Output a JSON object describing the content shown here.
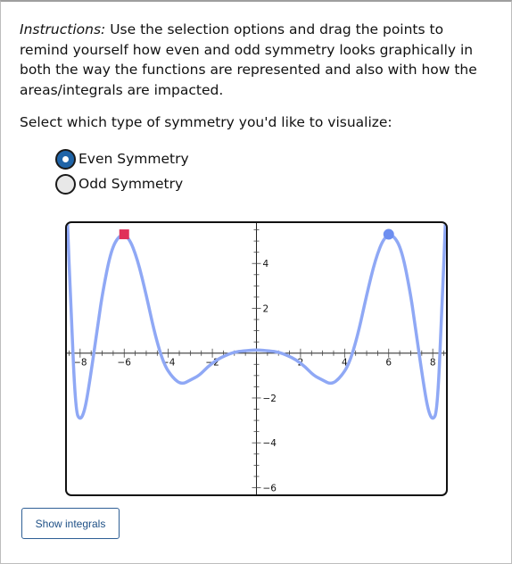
{
  "instructions": {
    "lead": "Instructions:",
    "text": " Use the selection options and drag the points to remind yourself how even and odd symmetry looks graphically in both the way the functions are represented and also with how the areas/integrals are impacted."
  },
  "question": "Select which type of symmetry you'd like to visualize:",
  "options": [
    {
      "label": "Even Symmetry",
      "selected": true
    },
    {
      "label": "Odd Symmetry",
      "selected": false
    }
  ],
  "button": {
    "label": "Show integrals"
  },
  "colors": {
    "curve": "#8fa8f5",
    "point_left": "#e0305a",
    "point_right": "#6d8ef0",
    "radio_selected": "#1f64a8"
  },
  "chart_data": {
    "type": "line",
    "xlim": [
      -8.6,
      8.6
    ],
    "ylim": [
      -6.3,
      5.8
    ],
    "x_ticks": [
      -8,
      -6,
      -4,
      -2,
      2,
      4,
      6,
      8
    ],
    "y_ticks": [
      -6,
      -4,
      -2,
      2,
      4
    ],
    "x_tick_labels": [
      "−8",
      "−6",
      "−4",
      "−2",
      "2",
      "4",
      "6",
      "8"
    ],
    "y_tick_labels": [
      "−6",
      "−4",
      "−2",
      "2",
      "4"
    ],
    "series": [
      {
        "x": [
          -8.6,
          -8.4,
          -8.2,
          -8.0,
          -7.8,
          -7.6,
          -7.2,
          -7.0,
          -6.6,
          -6.2,
          -5.8,
          -5.4,
          -5.0,
          -4.6,
          -4.2,
          -3.8,
          -3.4,
          -3.0,
          -2.6,
          -2.2,
          -1.8,
          -1.4,
          -1.0,
          -0.6,
          0,
          0.6,
          1.0,
          1.4,
          1.8,
          2.2,
          2.6,
          3.0,
          3.4,
          3.8,
          4.2,
          4.6,
          5.0,
          5.4,
          5.8,
          6.2,
          6.6,
          7.0,
          7.2,
          7.6,
          7.8,
          8.0,
          8.2,
          8.4,
          8.6
        ],
        "y": [
          6.5,
          1.5,
          -2.6,
          -3.0,
          -2.6,
          -1.5,
          1.2,
          2.6,
          4.6,
          5.3,
          5.2,
          4.2,
          2.6,
          0.8,
          -0.5,
          -1.1,
          -1.4,
          -1.2,
          -1.0,
          -0.6,
          -0.3,
          -0.1,
          0.05,
          0.1,
          0.15,
          0.1,
          0.05,
          -0.1,
          -0.3,
          -0.6,
          -1.0,
          -1.2,
          -1.4,
          -1.1,
          -0.5,
          0.8,
          2.6,
          4.2,
          5.2,
          5.3,
          4.6,
          2.6,
          1.2,
          -1.5,
          -2.6,
          -3.0,
          -2.6,
          1.5,
          6.5
        ]
      }
    ],
    "points": [
      {
        "x": -6.0,
        "y": 5.3,
        "shape": "square"
      },
      {
        "x": 6.0,
        "y": 5.3,
        "shape": "circle"
      }
    ]
  }
}
